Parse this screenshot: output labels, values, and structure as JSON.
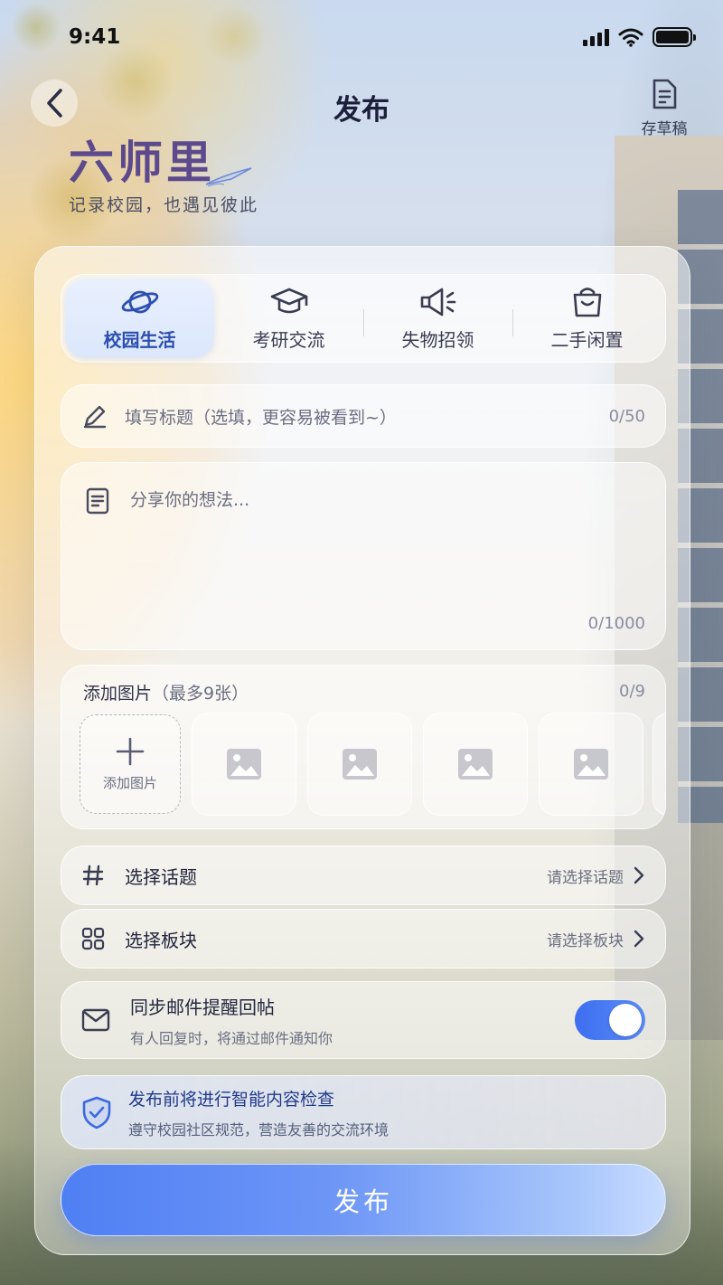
{
  "status_bar": {
    "time": "9:41"
  },
  "header": {
    "title": "发布",
    "draft_label": "存草稿"
  },
  "brand": {
    "name": "六师里",
    "slogan": "记录校园，也遇见彼此"
  },
  "categories": [
    {
      "label": "校园生活",
      "icon": "planet-icon",
      "active": true
    },
    {
      "label": "考研交流",
      "icon": "graduation-cap-icon",
      "active": false
    },
    {
      "label": "失物招领",
      "icon": "megaphone-icon",
      "active": false
    },
    {
      "label": "二手闲置",
      "icon": "shopping-bag-icon",
      "active": false
    }
  ],
  "title_field": {
    "placeholder": "填写标题（选填，更容易被看到~）",
    "counter": "0/50"
  },
  "content_field": {
    "placeholder": "分享你的想法...",
    "counter": "0/1000"
  },
  "images": {
    "title": "添加图片",
    "limit": "（最多9张）",
    "counter": "0/9",
    "add_label": "添加图片"
  },
  "topic_row": {
    "label": "选择话题",
    "value": "请选择话题"
  },
  "board_row": {
    "label": "选择板块",
    "value": "请选择板块"
  },
  "email_notify": {
    "title": "同步邮件提醒回帖",
    "subtitle": "有人回复时，将通过邮件通知你",
    "enabled": true
  },
  "notice": {
    "title": "发布前将进行智能内容检查",
    "subtitle": "遵守校园社区规范，营造友善的交流环境"
  },
  "publish_label": "发布",
  "colors": {
    "accent": "#3d6ef0",
    "active_tab_text": "#2c4fb0",
    "brand": "#5c4a8c"
  }
}
